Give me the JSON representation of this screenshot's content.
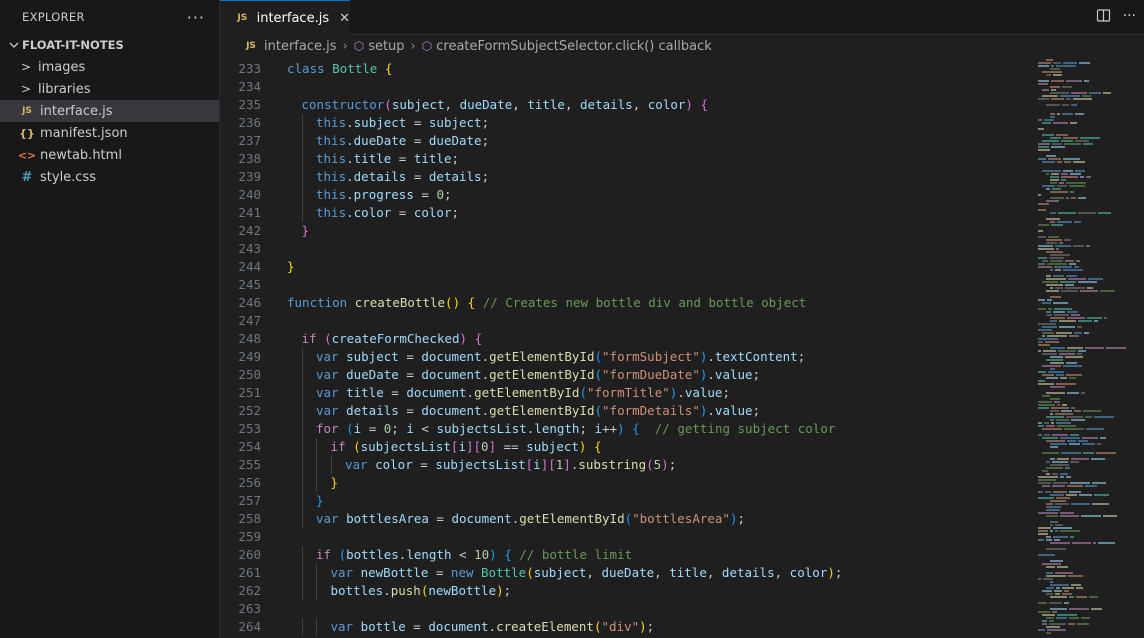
{
  "explorer": {
    "title": "EXPLORER",
    "more": "···",
    "folder": "FLOAT-IT-NOTES",
    "items": [
      {
        "name": "images",
        "type": "folder",
        "icon": ">"
      },
      {
        "name": "libraries",
        "type": "folder",
        "icon": ">"
      },
      {
        "name": "interface.js",
        "type": "js",
        "icon": "JS",
        "active": true
      },
      {
        "name": "manifest.json",
        "type": "json",
        "icon": "{}"
      },
      {
        "name": "newtab.html",
        "type": "html",
        "icon": "<>"
      },
      {
        "name": "style.css",
        "type": "css",
        "icon": "#"
      }
    ]
  },
  "tab": {
    "icon": "JS",
    "label": "interface.js",
    "close": "✕"
  },
  "breadcrumb": {
    "file": "interface.js",
    "symbol1": "setup",
    "symbol2": "createFormSubjectSelector.click() callback"
  },
  "editor": {
    "lines": [
      {
        "n": "233",
        "indent": 0,
        "toks": [
          [
            "class ",
            "kw"
          ],
          [
            "Bottle ",
            "cls"
          ],
          [
            "{",
            "b1"
          ]
        ]
      },
      {
        "n": "234",
        "indent": 0,
        "toks": []
      },
      {
        "n": "235",
        "indent": 1,
        "toks": [
          [
            "constructor",
            "kw"
          ],
          [
            "(",
            "b2"
          ],
          [
            "subject",
            "prm"
          ],
          [
            ", ",
            "plain"
          ],
          [
            "dueDate",
            "prm"
          ],
          [
            ", ",
            "plain"
          ],
          [
            "title",
            "prm"
          ],
          [
            ", ",
            "plain"
          ],
          [
            "details",
            "prm"
          ],
          [
            ", ",
            "plain"
          ],
          [
            "color",
            "prm"
          ],
          [
            ") ",
            "b2"
          ],
          [
            "{",
            "b2"
          ]
        ]
      },
      {
        "n": "236",
        "indent": 2,
        "toks": [
          [
            "this",
            "kw"
          ],
          [
            ".",
            "plain"
          ],
          [
            "subject",
            "prm"
          ],
          [
            " = ",
            "plain"
          ],
          [
            "subject",
            "prm"
          ],
          [
            ";",
            "plain"
          ]
        ]
      },
      {
        "n": "237",
        "indent": 2,
        "toks": [
          [
            "this",
            "kw"
          ],
          [
            ".",
            "plain"
          ],
          [
            "dueDate",
            "prm"
          ],
          [
            " = ",
            "plain"
          ],
          [
            "dueDate",
            "prm"
          ],
          [
            ";",
            "plain"
          ]
        ]
      },
      {
        "n": "238",
        "indent": 2,
        "toks": [
          [
            "this",
            "kw"
          ],
          [
            ".",
            "plain"
          ],
          [
            "title",
            "prm"
          ],
          [
            " = ",
            "plain"
          ],
          [
            "title",
            "prm"
          ],
          [
            ";",
            "plain"
          ]
        ]
      },
      {
        "n": "239",
        "indent": 2,
        "toks": [
          [
            "this",
            "kw"
          ],
          [
            ".",
            "plain"
          ],
          [
            "details",
            "prm"
          ],
          [
            " = ",
            "plain"
          ],
          [
            "details",
            "prm"
          ],
          [
            ";",
            "plain"
          ]
        ]
      },
      {
        "n": "240",
        "indent": 2,
        "toks": [
          [
            "this",
            "kw"
          ],
          [
            ".",
            "plain"
          ],
          [
            "progress",
            "prm"
          ],
          [
            " = ",
            "plain"
          ],
          [
            "0",
            "num"
          ],
          [
            ";",
            "plain"
          ]
        ]
      },
      {
        "n": "241",
        "indent": 2,
        "toks": [
          [
            "this",
            "kw"
          ],
          [
            ".",
            "plain"
          ],
          [
            "color",
            "prm"
          ],
          [
            " = ",
            "plain"
          ],
          [
            "color",
            "prm"
          ],
          [
            ";",
            "plain"
          ]
        ]
      },
      {
        "n": "242",
        "indent": 1,
        "toks": [
          [
            "}",
            "b2"
          ]
        ]
      },
      {
        "n": "243",
        "indent": 0,
        "toks": []
      },
      {
        "n": "244",
        "indent": 0,
        "toks": [
          [
            "}",
            "b1"
          ]
        ]
      },
      {
        "n": "245",
        "indent": 0,
        "toks": []
      },
      {
        "n": "246",
        "indent": 0,
        "toks": [
          [
            "function ",
            "kw"
          ],
          [
            "createBottle",
            "fn"
          ],
          [
            "() ",
            "b1"
          ],
          [
            "{ ",
            "b1"
          ],
          [
            "// Creates new bottle div and bottle object",
            "cmt"
          ]
        ]
      },
      {
        "n": "247",
        "indent": 0,
        "toks": []
      },
      {
        "n": "248",
        "indent": 1,
        "toks": [
          [
            "if ",
            "ctl"
          ],
          [
            "(",
            "b2"
          ],
          [
            "createFormChecked",
            "prm"
          ],
          [
            ") ",
            "b2"
          ],
          [
            "{",
            "b2"
          ]
        ]
      },
      {
        "n": "249",
        "indent": 2,
        "toks": [
          [
            "var ",
            "kw"
          ],
          [
            "subject",
            "prm"
          ],
          [
            " = ",
            "plain"
          ],
          [
            "document",
            "prm"
          ],
          [
            ".",
            "plain"
          ],
          [
            "getElementById",
            "fn"
          ],
          [
            "(",
            "b3"
          ],
          [
            "\"formSubject\"",
            "str"
          ],
          [
            ")",
            "b3"
          ],
          [
            ".",
            "plain"
          ],
          [
            "textContent",
            "prm"
          ],
          [
            ";",
            "plain"
          ]
        ]
      },
      {
        "n": "250",
        "indent": 2,
        "toks": [
          [
            "var ",
            "kw"
          ],
          [
            "dueDate",
            "prm"
          ],
          [
            " = ",
            "plain"
          ],
          [
            "document",
            "prm"
          ],
          [
            ".",
            "plain"
          ],
          [
            "getElementById",
            "fn"
          ],
          [
            "(",
            "b3"
          ],
          [
            "\"formDueDate\"",
            "str"
          ],
          [
            ")",
            "b3"
          ],
          [
            ".",
            "plain"
          ],
          [
            "value",
            "prm"
          ],
          [
            ";",
            "plain"
          ]
        ]
      },
      {
        "n": "251",
        "indent": 2,
        "toks": [
          [
            "var ",
            "kw"
          ],
          [
            "title",
            "prm"
          ],
          [
            " = ",
            "plain"
          ],
          [
            "document",
            "prm"
          ],
          [
            ".",
            "plain"
          ],
          [
            "getElementById",
            "fn"
          ],
          [
            "(",
            "b3"
          ],
          [
            "\"formTitle\"",
            "str"
          ],
          [
            ")",
            "b3"
          ],
          [
            ".",
            "plain"
          ],
          [
            "value",
            "prm"
          ],
          [
            ";",
            "plain"
          ]
        ]
      },
      {
        "n": "252",
        "indent": 2,
        "toks": [
          [
            "var ",
            "kw"
          ],
          [
            "details",
            "prm"
          ],
          [
            " = ",
            "plain"
          ],
          [
            "document",
            "prm"
          ],
          [
            ".",
            "plain"
          ],
          [
            "getElementById",
            "fn"
          ],
          [
            "(",
            "b3"
          ],
          [
            "\"formDetails\"",
            "str"
          ],
          [
            ")",
            "b3"
          ],
          [
            ".",
            "plain"
          ],
          [
            "value",
            "prm"
          ],
          [
            ";",
            "plain"
          ]
        ]
      },
      {
        "n": "253",
        "indent": 2,
        "toks": [
          [
            "for ",
            "ctl"
          ],
          [
            "(",
            "b3"
          ],
          [
            "i",
            "prm"
          ],
          [
            " = ",
            "plain"
          ],
          [
            "0",
            "num"
          ],
          [
            "; ",
            "plain"
          ],
          [
            "i",
            "prm"
          ],
          [
            " < ",
            "plain"
          ],
          [
            "subjectsList",
            "prm"
          ],
          [
            ".",
            "plain"
          ],
          [
            "length",
            "prm"
          ],
          [
            "; ",
            "plain"
          ],
          [
            "i",
            "prm"
          ],
          [
            "++",
            "plain"
          ],
          [
            ") ",
            "b3"
          ],
          [
            "{  ",
            "b3"
          ],
          [
            "// getting subject color",
            "cmt"
          ]
        ]
      },
      {
        "n": "254",
        "indent": 3,
        "toks": [
          [
            "if ",
            "ctl"
          ],
          [
            "(",
            "b1"
          ],
          [
            "subjectsList",
            "prm"
          ],
          [
            "[",
            "b2"
          ],
          [
            "i",
            "prm"
          ],
          [
            "]",
            "b2"
          ],
          [
            "[",
            "b2"
          ],
          [
            "0",
            "num"
          ],
          [
            "]",
            "b2"
          ],
          [
            " == ",
            "plain"
          ],
          [
            "subject",
            "prm"
          ],
          [
            ") ",
            "b1"
          ],
          [
            "{",
            "b1"
          ]
        ]
      },
      {
        "n": "255",
        "indent": 4,
        "toks": [
          [
            "var ",
            "kw"
          ],
          [
            "color",
            "prm"
          ],
          [
            " = ",
            "plain"
          ],
          [
            "subjectsList",
            "prm"
          ],
          [
            "[",
            "b2"
          ],
          [
            "i",
            "prm"
          ],
          [
            "]",
            "b2"
          ],
          [
            "[",
            "b2"
          ],
          [
            "1",
            "num"
          ],
          [
            "]",
            "b2"
          ],
          [
            ".",
            "plain"
          ],
          [
            "substring",
            "fn"
          ],
          [
            "(",
            "b2"
          ],
          [
            "5",
            "num"
          ],
          [
            ")",
            "b2"
          ],
          [
            ";",
            "plain"
          ]
        ]
      },
      {
        "n": "256",
        "indent": 3,
        "toks": [
          [
            "}",
            "b1"
          ]
        ]
      },
      {
        "n": "257",
        "indent": 2,
        "toks": [
          [
            "}",
            "b3"
          ]
        ]
      },
      {
        "n": "258",
        "indent": 2,
        "toks": [
          [
            "var ",
            "kw"
          ],
          [
            "bottlesArea",
            "prm"
          ],
          [
            " = ",
            "plain"
          ],
          [
            "document",
            "prm"
          ],
          [
            ".",
            "plain"
          ],
          [
            "getElementById",
            "fn"
          ],
          [
            "(",
            "b3"
          ],
          [
            "\"bottlesArea\"",
            "str"
          ],
          [
            ")",
            "b3"
          ],
          [
            ";",
            "plain"
          ]
        ]
      },
      {
        "n": "259",
        "indent": 0,
        "toks": []
      },
      {
        "n": "260",
        "indent": 2,
        "toks": [
          [
            "if ",
            "ctl"
          ],
          [
            "(",
            "b3"
          ],
          [
            "bottles",
            "prm"
          ],
          [
            ".",
            "plain"
          ],
          [
            "length",
            "prm"
          ],
          [
            " < ",
            "plain"
          ],
          [
            "10",
            "num"
          ],
          [
            ") ",
            "b3"
          ],
          [
            "{ ",
            "b3"
          ],
          [
            "// bottle limit",
            "cmt"
          ]
        ]
      },
      {
        "n": "261",
        "indent": 3,
        "toks": [
          [
            "var ",
            "kw"
          ],
          [
            "newBottle",
            "prm"
          ],
          [
            " = ",
            "plain"
          ],
          [
            "new ",
            "kw"
          ],
          [
            "Bottle",
            "cls"
          ],
          [
            "(",
            "b1"
          ],
          [
            "subject",
            "prm"
          ],
          [
            ", ",
            "plain"
          ],
          [
            "dueDate",
            "prm"
          ],
          [
            ", ",
            "plain"
          ],
          [
            "title",
            "prm"
          ],
          [
            ", ",
            "plain"
          ],
          [
            "details",
            "prm"
          ],
          [
            ", ",
            "plain"
          ],
          [
            "color",
            "prm"
          ],
          [
            ")",
            "b1"
          ],
          [
            ";",
            "plain"
          ]
        ]
      },
      {
        "n": "262",
        "indent": 3,
        "toks": [
          [
            "bottles",
            "prm"
          ],
          [
            ".",
            "plain"
          ],
          [
            "push",
            "fn"
          ],
          [
            "(",
            "b1"
          ],
          [
            "newBottle",
            "prm"
          ],
          [
            ")",
            "b1"
          ],
          [
            ";",
            "plain"
          ]
        ]
      },
      {
        "n": "263",
        "indent": 0,
        "toks": []
      },
      {
        "n": "264",
        "indent": 3,
        "toks": [
          [
            "var ",
            "kw"
          ],
          [
            "bottle",
            "prm"
          ],
          [
            " = ",
            "plain"
          ],
          [
            "document",
            "prm"
          ],
          [
            ".",
            "plain"
          ],
          [
            "createElement",
            "fn"
          ],
          [
            "(",
            "b1"
          ],
          [
            "\"div\"",
            "str"
          ],
          [
            ")",
            "b1"
          ],
          [
            ";",
            "plain"
          ]
        ]
      }
    ]
  },
  "colors": {
    "accent": "#0078d4",
    "editor_bg": "#1f1f1f",
    "sidebar_bg": "#181818"
  }
}
